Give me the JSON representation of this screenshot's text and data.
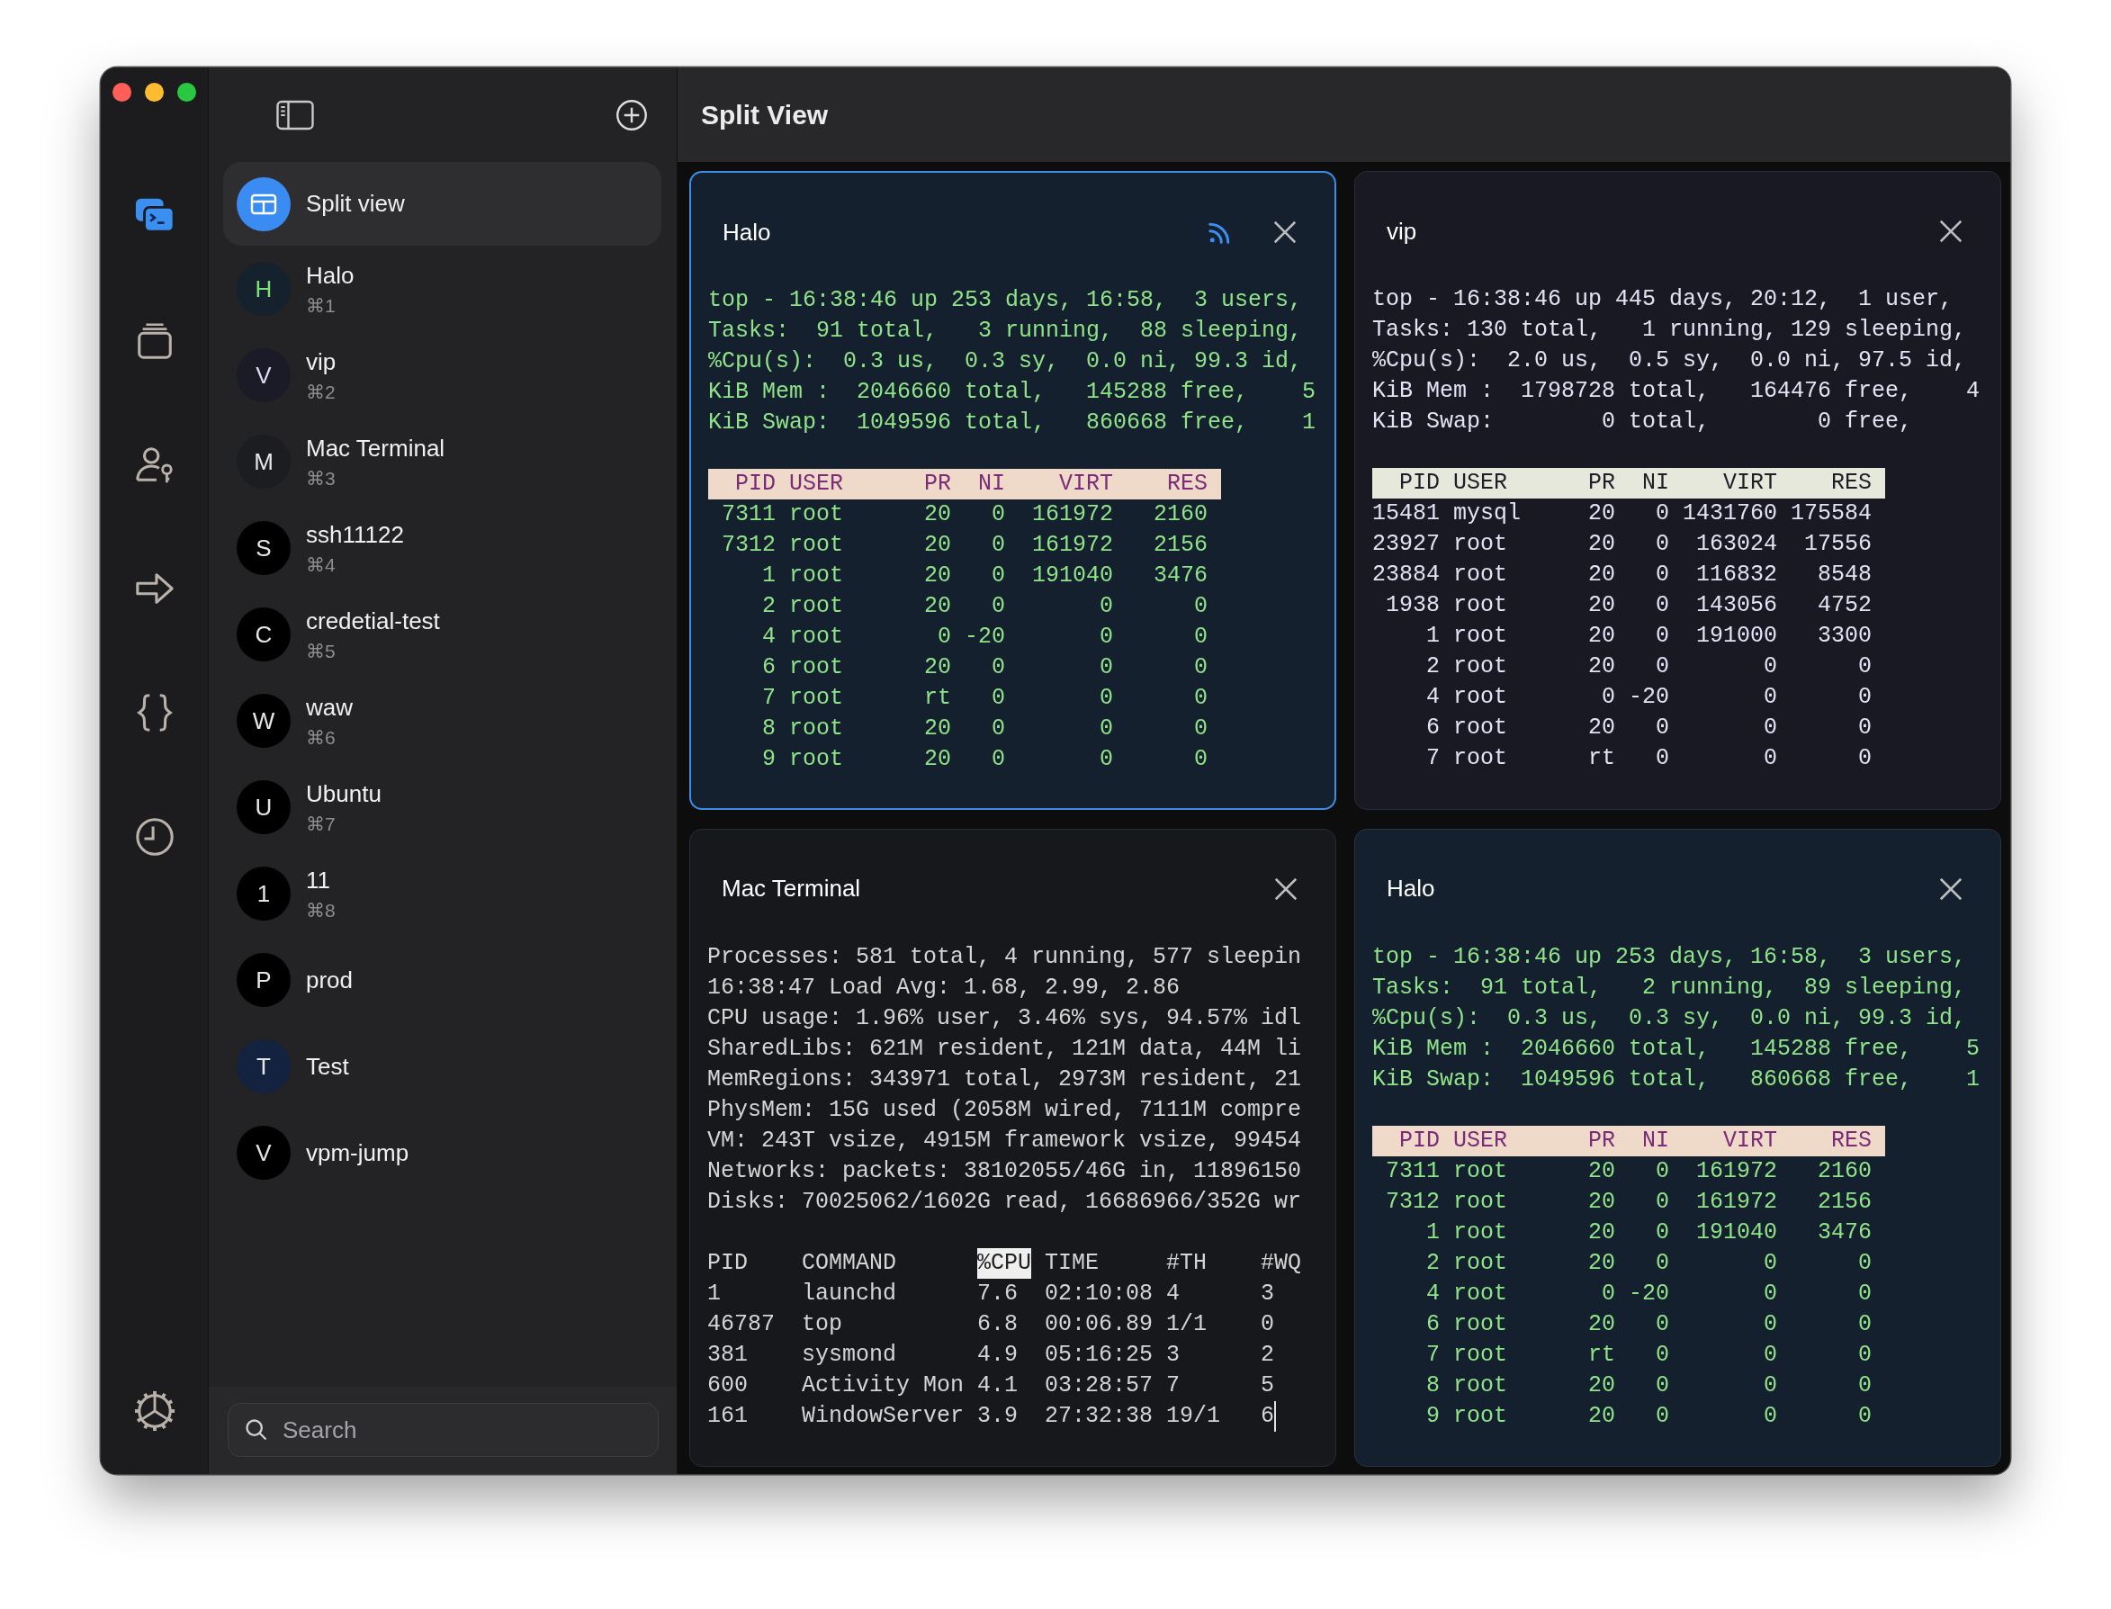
{
  "window": {
    "title": "Split View"
  },
  "rail": [
    {
      "kind": "terminal",
      "selected": true
    },
    {
      "kind": "stack",
      "selected": false
    },
    {
      "kind": "person-key",
      "selected": false
    },
    {
      "kind": "arrow",
      "selected": false
    },
    {
      "kind": "braces",
      "selected": false
    },
    {
      "kind": "clock",
      "selected": false
    },
    {
      "kind": "settings",
      "selected": false
    }
  ],
  "sidebar": {
    "items": [
      {
        "kind": "split",
        "name": "Split view",
        "selected": true
      },
      {
        "kind": "host",
        "name": "Halo",
        "initial": {
          "text": "H",
          "color": "#7fe07a"
        },
        "shortcut": "⌘1",
        "color": "#15212d",
        "selected": false
      },
      {
        "kind": "host",
        "name": "vip",
        "initial": {
          "text": "V",
          "color": "#dcdaf5"
        },
        "shortcut": "⌘2",
        "color": "#1b1a27",
        "selected": false
      },
      {
        "kind": "host",
        "name": "Mac Terminal",
        "initial": {
          "text": "M",
          "color": "#e6e6e6"
        },
        "shortcut": "⌘3",
        "color": "#1c1d20",
        "selected": false
      },
      {
        "kind": "host",
        "name": "ssh11122",
        "initial": {
          "text": "S",
          "color": "#e6e6e6"
        },
        "shortcut": "⌘4",
        "color": "#000000",
        "selected": false
      },
      {
        "kind": "host",
        "name": "credetial-test",
        "initial": {
          "text": "C",
          "color": "#e6e6e6"
        },
        "shortcut": "⌘5",
        "color": "#000000",
        "selected": false
      },
      {
        "kind": "host",
        "name": "waw",
        "initial": {
          "text": "W",
          "color": "#e6e6e6"
        },
        "shortcut": "⌘6",
        "color": "#000000",
        "selected": false
      },
      {
        "kind": "host",
        "name": "Ubuntu",
        "initial": {
          "text": "U",
          "color": "#e6e6e6"
        },
        "shortcut": "⌘7",
        "color": "#000000",
        "selected": false
      },
      {
        "kind": "host",
        "name": "11",
        "initial": {
          "text": "1",
          "color": "#e6e6e6"
        },
        "shortcut": "⌘8",
        "color": "#000000",
        "selected": false
      },
      {
        "kind": "host",
        "name": "prod",
        "initial": {
          "text": "P",
          "color": "#e6e6e6"
        },
        "color": "#000000",
        "selected": false
      },
      {
        "kind": "host",
        "name": "Test",
        "initial": {
          "text": "T",
          "color": "#e6e6e6"
        },
        "color": "#12223f",
        "selected": false
      },
      {
        "kind": "host",
        "name": "vpm-jump",
        "initial": {
          "text": "V",
          "color": "#e6e6e6"
        },
        "color": "#000000",
        "selected": false
      }
    ],
    "search": {
      "placeholder": "Search"
    }
  },
  "panes": [
    {
      "title": "Halo",
      "selected": true,
      "broadcast": true,
      "kind": "green",
      "lines": [
        {
          "kind": "text",
          "text": "top - 16:38:46 up 253 days, 16:58,  3 users,"
        },
        {
          "kind": "text",
          "text": "Tasks:  91 total,   3 running,  88 sleeping,"
        },
        {
          "kind": "text",
          "text": "%Cpu(s):  0.3 us,  0.3 sy,  0.0 ni, 99.3 id,"
        },
        {
          "kind": "text",
          "text": "KiB Mem :  2046660 total,   145288 free,    5"
        },
        {
          "kind": "text",
          "text": "KiB Swap:  1049596 total,   860668 free,    1"
        },
        {
          "kind": "blank"
        },
        {
          "kind": "bar",
          "text": "  PID USER      PR  NI    VIRT    RES"
        },
        {
          "kind": "text",
          "text": " 7311 root      20   0  161972   2160"
        },
        {
          "kind": "text",
          "text": " 7312 root      20   0  161972   2156"
        },
        {
          "kind": "text",
          "text": "    1 root      20   0  191040   3476"
        },
        {
          "kind": "text",
          "text": "    2 root      20   0       0      0"
        },
        {
          "kind": "text",
          "text": "    4 root       0 -20       0      0"
        },
        {
          "kind": "text",
          "text": "    6 root      20   0       0      0"
        },
        {
          "kind": "text",
          "text": "    7 root      rt   0       0      0"
        },
        {
          "kind": "text",
          "text": "    8 root      20   0       0      0"
        },
        {
          "kind": "text",
          "text": "    9 root      20   0       0      0"
        }
      ]
    },
    {
      "title": "vip",
      "selected": false,
      "broadcast": false,
      "kind": "light",
      "lines": [
        {
          "kind": "text",
          "text": "top - 16:38:46 up 445 days, 20:12,  1 user,"
        },
        {
          "kind": "text",
          "text": "Tasks: 130 total,   1 running, 129 sleeping,"
        },
        {
          "kind": "text",
          "text": "%Cpu(s):  2.0 us,  0.5 sy,  0.0 ni, 97.5 id,"
        },
        {
          "kind": "text",
          "text": "KiB Mem :  1798728 total,   164476 free,    4"
        },
        {
          "kind": "text",
          "text": "KiB Swap:        0 total,        0 free,"
        },
        {
          "kind": "blank"
        },
        {
          "kind": "bar",
          "text": "  PID USER      PR  NI    VIRT    RES"
        },
        {
          "kind": "text",
          "text": "15481 mysql     20   0 1431760 175584"
        },
        {
          "kind": "text",
          "text": "23927 root      20   0  163024  17556"
        },
        {
          "kind": "text",
          "text": "23884 root      20   0  116832   8548"
        },
        {
          "kind": "text",
          "text": " 1938 root      20   0  143056   4752"
        },
        {
          "kind": "text",
          "text": "    1 root      20   0  191000   3300"
        },
        {
          "kind": "text",
          "text": "    2 root      20   0       0      0"
        },
        {
          "kind": "text",
          "text": "    4 root       0 -20       0      0"
        },
        {
          "kind": "text",
          "text": "    6 root      20   0       0      0"
        },
        {
          "kind": "text",
          "text": "    7 root      rt   0       0      0"
        }
      ]
    },
    {
      "title": "Mac Terminal",
      "selected": false,
      "broadcast": false,
      "kind": "gray",
      "lines": [
        {
          "kind": "text",
          "text": "Processes: 581 total, 4 running, 577 sleepin"
        },
        {
          "kind": "text",
          "text": "16:38:47 Load Avg: 1.68, 2.99, 2.86"
        },
        {
          "kind": "text",
          "text": "CPU usage: 1.96% user, 3.46% sys, 94.57% idl"
        },
        {
          "kind": "text",
          "text": "SharedLibs: 621M resident, 121M data, 44M li"
        },
        {
          "kind": "text",
          "text": "MemRegions: 343971 total, 2973M resident, 21"
        },
        {
          "kind": "text",
          "text": "PhysMem: 15G used (2058M wired, 7111M compre"
        },
        {
          "kind": "text",
          "text": "VM: 243T vsize, 4915M framework vsize, 99454"
        },
        {
          "kind": "text",
          "text": "Networks: packets: 38102055/46G in, 11896150"
        },
        {
          "kind": "text",
          "text": "Disks: 70025062/1602G read, 16686966/352G wr"
        },
        {
          "kind": "blank"
        },
        {
          "kind": "header",
          "segments": [
            {
              "text": "PID    COMMAND      ",
              "highlighted": false
            },
            {
              "text": "%CPU",
              "highlighted": true
            },
            {
              "text": " TIME     #TH    #WQ",
              "highlighted": false
            }
          ]
        },
        {
          "kind": "text",
          "text": "1      launchd      7.6  02:10:08 4      3"
        },
        {
          "kind": "text",
          "text": "46787  top          6.8  00:06.89 1/1    0"
        },
        {
          "kind": "text",
          "text": "381    sysmond      4.9  05:16:25 3      2"
        },
        {
          "kind": "text",
          "text": "600    Activity Mon 4.1  03:28:57 7      5"
        },
        {
          "kind": "text",
          "text": "161    WindowServer 3.9  27:32:38 19/1   6",
          "cursor": true
        }
      ]
    },
    {
      "title": "Halo",
      "selected": false,
      "broadcast": false,
      "kind": "green",
      "lines": [
        {
          "kind": "text",
          "text": "top - 16:38:46 up 253 days, 16:58,  3 users,"
        },
        {
          "kind": "text",
          "text": "Tasks:  91 total,   2 running,  89 sleeping,"
        },
        {
          "kind": "text",
          "text": "%Cpu(s):  0.3 us,  0.3 sy,  0.0 ni, 99.3 id,"
        },
        {
          "kind": "text",
          "text": "KiB Mem :  2046660 total,   145288 free,    5"
        },
        {
          "kind": "text",
          "text": "KiB Swap:  1049596 total,   860668 free,    1"
        },
        {
          "kind": "blank"
        },
        {
          "kind": "bar",
          "text": "  PID USER      PR  NI    VIRT    RES"
        },
        {
          "kind": "text",
          "text": " 7311 root      20   0  161972   2160"
        },
        {
          "kind": "text",
          "text": " 7312 root      20   0  161972   2156"
        },
        {
          "kind": "text",
          "text": "    1 root      20   0  191040   3476"
        },
        {
          "kind": "text",
          "text": "    2 root      20   0       0      0"
        },
        {
          "kind": "text",
          "text": "    4 root       0 -20       0      0"
        },
        {
          "kind": "text",
          "text": "    6 root      20   0       0      0"
        },
        {
          "kind": "text",
          "text": "    7 root      rt   0       0      0"
        },
        {
          "kind": "text",
          "text": "    8 root      20   0       0      0"
        },
        {
          "kind": "text",
          "text": "    9 root      20   0       0      0"
        }
      ]
    }
  ]
}
